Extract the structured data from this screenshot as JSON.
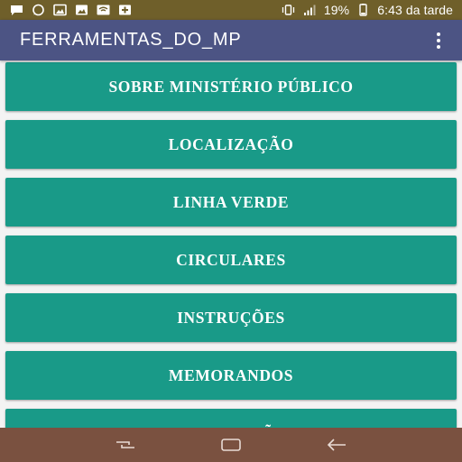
{
  "status_bar": {
    "left_icons": [
      "message-icon",
      "whatsapp-icon",
      "image-icon",
      "photo-icon",
      "wifi-icon",
      "medical-icon"
    ],
    "right_icons": [
      "vibrate-icon",
      "signal-icon",
      "battery-icon"
    ],
    "battery_percent": "19%",
    "time": "6:43 da tarde"
  },
  "app_bar": {
    "title": "FERRAMENTAS_DO_MP",
    "overflow_icon": "more-vert-icon"
  },
  "menu": {
    "items": [
      {
        "label": "SOBRE MINISTÉRIO PÚBLICO"
      },
      {
        "label": "LOCALIZAÇÃO"
      },
      {
        "label": "LINHA VERDE"
      },
      {
        "label": "CIRCULARES"
      },
      {
        "label": "INSTRUÇÕES"
      },
      {
        "label": "MEMORANDOS"
      },
      {
        "label": "NOTIFICAÇÕES"
      }
    ]
  },
  "nav_bar": {
    "buttons": [
      "recent-apps-icon",
      "home-icon",
      "back-icon"
    ]
  },
  "colors": {
    "status_bar": "#6f5f2a",
    "app_bar": "#4c5484",
    "menu_button": "#199a88",
    "nav_bar": "#7a5140",
    "background": "#f3f3f3"
  }
}
